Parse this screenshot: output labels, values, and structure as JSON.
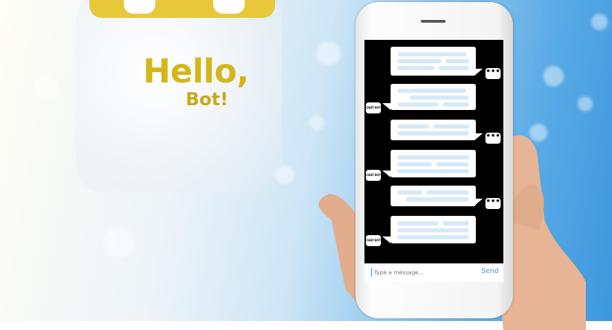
{
  "headline": {
    "greeting": "Hello,",
    "name": "Bot!"
  },
  "phone_ui": {
    "avatars": {
      "user_symbol": "•••",
      "bot_label": "CHAT BOT"
    },
    "composer": {
      "placeholder": "Type a message...",
      "send_label": "Send"
    }
  },
  "colors": {
    "headline": "#d4b61a",
    "screen_bg": "#000000",
    "bubble": "#ffffff",
    "bubble_line": "#d6e9f7",
    "send": "#4e8fd0"
  },
  "icons": [
    "typing-dots-icon",
    "chat-bot-icon"
  ]
}
